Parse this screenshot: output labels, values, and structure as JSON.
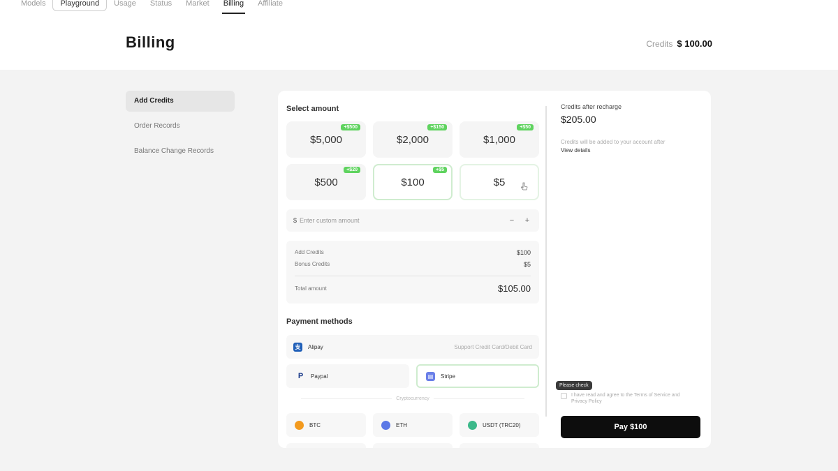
{
  "nav": {
    "items": [
      {
        "label": "Models"
      },
      {
        "label": "Playground"
      },
      {
        "label": "Usage"
      },
      {
        "label": "Status"
      },
      {
        "label": "Market"
      },
      {
        "label": "Billing"
      },
      {
        "label": "Affiliate"
      }
    ]
  },
  "header": {
    "title": "Billing",
    "credits_label": "Credits",
    "credits_value": "$ 100.00"
  },
  "sidebar": {
    "items": [
      {
        "label": "Add Credits"
      },
      {
        "label": "Order Records"
      },
      {
        "label": "Balance Change Records"
      }
    ]
  },
  "amount": {
    "title": "Select amount",
    "options": [
      {
        "value": "$5,000",
        "badge": "+$500"
      },
      {
        "value": "$2,000",
        "badge": "+$150"
      },
      {
        "value": "$1,000",
        "badge": "+$50"
      },
      {
        "value": "$500",
        "badge": "+$20"
      },
      {
        "value": "$100",
        "badge": "+$5"
      },
      {
        "value": "$5",
        "badge": ""
      }
    ],
    "custom_prefix": "$",
    "custom_placeholder": "Enter custom amount",
    "minus": "−",
    "plus": "+"
  },
  "summary": {
    "add_credits_label": "Add Credits",
    "add_credits_value": "$100",
    "bonus_label": "Bonus Credits",
    "bonus_value": "$5",
    "total_label": "Total amount",
    "total_value": "$105.00"
  },
  "payment": {
    "title": "Payment methods",
    "wide": {
      "label": "Alipay",
      "note": "Support Credit Card/Debit Card"
    },
    "methods": [
      {
        "label": "Paypal"
      },
      {
        "label": "Stripe"
      }
    ],
    "crypto_label": "Cryptocurrency",
    "crypto": [
      {
        "label": "BTC",
        "color": "#f39a1e"
      },
      {
        "label": "ETH",
        "color": "#5b78e6"
      },
      {
        "label": "USDT (TRC20)",
        "color": "#3cb98a"
      }
    ]
  },
  "right": {
    "after_label": "Credits after recharge",
    "after_value": "$205.00",
    "note": "Credits will be added to your account after",
    "note_link": "View details",
    "tooltip": "Please check",
    "agree_text": "I have read and agree to the Terms of Service and Privacy Policy",
    "pay_label": "Pay $100"
  },
  "colors": {
    "accent_green": "#5fd35f",
    "pay_button": "#0d0d0d"
  }
}
